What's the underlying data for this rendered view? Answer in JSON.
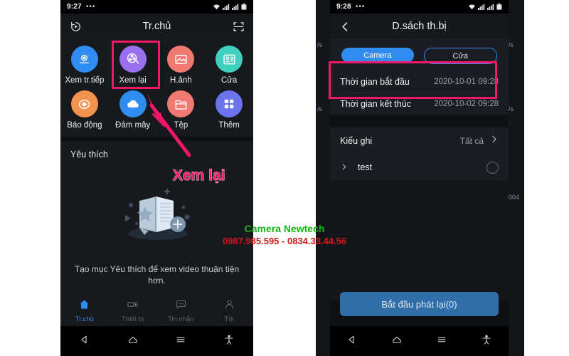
{
  "left_phone": {
    "status_bar": {
      "time": "9:27",
      "dots": "•••",
      "icons": [
        "wifi-icon",
        "signal-icon",
        "signal-icon",
        "battery-icon"
      ]
    },
    "header": {
      "title": "Tr.chủ",
      "left_icon": "history-replay-icon",
      "right_icon": "scan-qr-icon"
    },
    "grid": [
      {
        "label": "Xem tr.tiếp",
        "icon": "live-camera-icon",
        "color": "#2f8cf0"
      },
      {
        "label": "Xem lại",
        "icon": "film-reel-icon",
        "color": "#9b6ff0"
      },
      {
        "label": "H.ảnh",
        "icon": "photo-icon",
        "color": "#f07a72"
      },
      {
        "label": "Cửa",
        "icon": "door-panel-icon",
        "color": "#3fd0c0"
      },
      {
        "label": "Báo động",
        "icon": "alarm-icon",
        "color": "#f2944e"
      },
      {
        "label": "Đám mây",
        "icon": "cloud-icon",
        "color": "#2f8cf0"
      },
      {
        "label": "Tệp",
        "icon": "folder-icon",
        "color": "#f07a72"
      },
      {
        "label": "Thêm",
        "icon": "grid-more-icon",
        "color": "#6b74ec"
      }
    ],
    "favourites": {
      "title": "Yêu thích",
      "illustration": "empty-favourites-illustration",
      "caption": "Tạo mục Yêu thích để xem video thuận tiện hơn."
    },
    "bottom_nav": [
      {
        "label": "Tr.chủ",
        "icon": "home-icon",
        "selected": true
      },
      {
        "label": "Thiết bị",
        "icon": "device-icon",
        "selected": false
      },
      {
        "label": "Tin nhắn",
        "icon": "message-icon",
        "selected": false
      },
      {
        "label": "Tôi",
        "icon": "person-icon",
        "selected": false
      }
    ]
  },
  "right_phone": {
    "status_bar": {
      "time": "9:28",
      "dots": "•••",
      "icons": [
        "wifi-icon",
        "signal-icon",
        "signal-icon",
        "battery-icon"
      ]
    },
    "header": {
      "title": "D.sách th.bị",
      "left_icon": "back-chevron-icon"
    },
    "tabs": [
      {
        "label": "Camera",
        "selected": true
      },
      {
        "label": "Cửa",
        "selected": false
      }
    ],
    "time_rows": [
      {
        "label": "Thời gian bắt đầu",
        "value": "2020-10-01 09:28"
      },
      {
        "label": "Thời gian kết thúc",
        "value": "2020-10-02 09:28"
      }
    ],
    "record_type": {
      "label": "Kiểu ghi",
      "value": "Tất cả",
      "icon": "chevron-right-icon"
    },
    "device_row": {
      "name": "test",
      "expand_icon": "chevron-right-icon",
      "select_icon": "radio-unchecked-icon"
    },
    "cta": {
      "label": "Bắt đầu phát lại(0)"
    }
  },
  "background_layer": {
    "fragments": [
      "/s",
      "/s",
      "004"
    ]
  },
  "annotations": {
    "highlight_label": "Xem lại",
    "arrow": "pink-arrow",
    "highlight_color": "#f3176a"
  },
  "watermark": {
    "line1": "Camera Newtech",
    "line2": "0987.985.595 - 0834.33.44.56",
    "color1": "#12b712",
    "color2": "#d31919"
  },
  "android_nav": [
    "back-triangle-icon",
    "home-circle-icon",
    "recents-menu-icon",
    "accessibility-icon"
  ]
}
